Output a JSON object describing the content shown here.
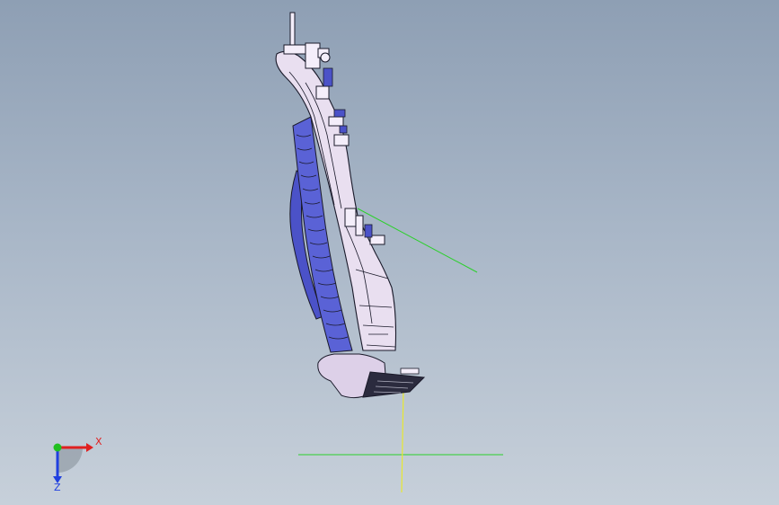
{
  "triad": {
    "x_label": "X",
    "z_label": "Z"
  },
  "colors": {
    "background_top": "#8e9fb4",
    "background_bottom": "#c7d0da",
    "part_body": "#e9dff0",
    "part_edge": "#1a1a2a",
    "part_accent": "#4b52c8",
    "ref_line_green": "#2bd02b",
    "ref_line_yellow": "#e8e830",
    "axis_x": "#e02020",
    "axis_y": "#20c020",
    "axis_z": "#2040e0"
  }
}
